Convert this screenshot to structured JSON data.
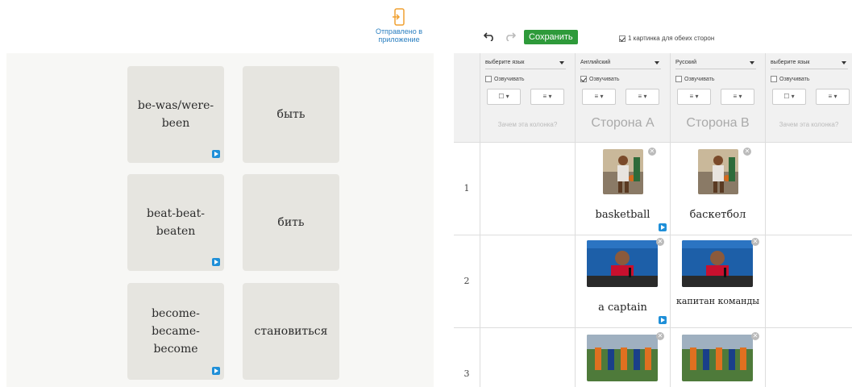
{
  "sent_indicator": {
    "label": "Отправлено в приложение"
  },
  "cards": [
    {
      "front": "be-was/were-been",
      "back": "быть"
    },
    {
      "front": "beat-beat-beaten",
      "back": "бить"
    },
    {
      "front": "become-became-become",
      "back": "становиться"
    }
  ],
  "toolbar": {
    "undo_icon": "undo-arrow-icon",
    "redo_icon": "redo-arrow-icon",
    "save_label": "Сохранить",
    "same_picture_label": "1 картинка для обеих сторон",
    "same_picture_checked": true
  },
  "columns": [
    {
      "language": "выберите язык",
      "voice_label": "Озвучивать",
      "voice_checked": false,
      "note": "Зачем эта колонка?",
      "side": ""
    },
    {
      "language": "Английский",
      "voice_label": "Озвучивать",
      "voice_checked": true,
      "note": "",
      "side": "Сторона A"
    },
    {
      "language": "Русский",
      "voice_label": "Озвучивать",
      "voice_checked": false,
      "note": "",
      "side": "Сторона B"
    },
    {
      "language": "выберите язык",
      "voice_label": "Озвучивать",
      "voice_checked": false,
      "note": "Зачем эта колонка?",
      "side": ""
    }
  ],
  "rows": [
    {
      "num": "1",
      "side_a": "basketball",
      "side_b": "баскетбол"
    },
    {
      "num": "2",
      "side_a": "a captain",
      "side_b": "капитан команды"
    },
    {
      "num": "3",
      "side_a": "",
      "side_b": ""
    }
  ],
  "colors": {
    "save": "#2e9a3a",
    "play": "#1f8fd8",
    "sent": "#2a7fc0"
  }
}
